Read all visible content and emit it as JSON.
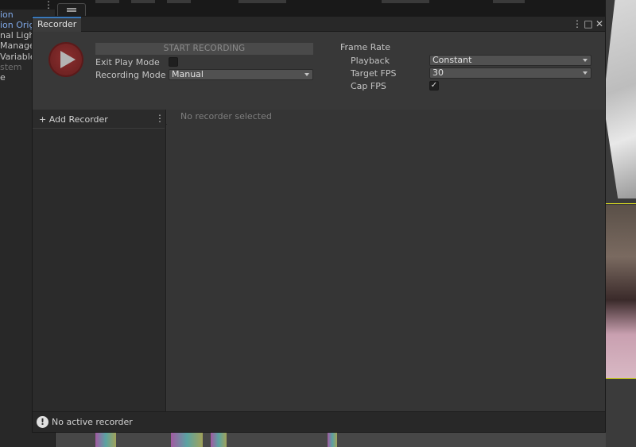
{
  "background": {
    "hierarchy_items": [
      {
        "label": "ion",
        "color": "#7fa8e8"
      },
      {
        "label": "ion Origi",
        "color": "#7fa8e8"
      },
      {
        "label": "nal Light",
        "color": "#c4c4c4"
      },
      {
        "label": "Manage",
        "color": "#c4c4c4"
      },
      {
        "label": "Variables",
        "color": "#c4c4c4"
      },
      {
        "label": "stem",
        "color": "#6e6e6e"
      },
      {
        "label": "e",
        "color": "#c4c4c4"
      }
    ],
    "menu_icon": "⋮"
  },
  "window": {
    "title": "Recorder",
    "controls": {
      "menu": "⋮",
      "maximize": "□",
      "close": "✕"
    }
  },
  "toolbar": {
    "start_button": "START RECORDING",
    "exit_play_mode_label": "Exit Play Mode",
    "exit_play_mode_checked": false,
    "recording_mode_label": "Recording Mode",
    "recording_mode_value": "Manual",
    "frame_rate_header": "Frame Rate",
    "playback_label": "Playback",
    "playback_value": "Constant",
    "target_fps_label": "Target FPS",
    "target_fps_value": "30",
    "cap_fps_label": "Cap FPS",
    "cap_fps_checked": true,
    "checkmark_glyph": "✓"
  },
  "recorder_list": {
    "add_label": "+ Add Recorder",
    "menu_glyph": "⋮"
  },
  "details": {
    "empty_text": "No recorder selected"
  },
  "status": {
    "icon_glyph": "!",
    "text": "No active recorder"
  },
  "colors": {
    "accent": "#3a79bb",
    "record_button": "#6e2222"
  }
}
